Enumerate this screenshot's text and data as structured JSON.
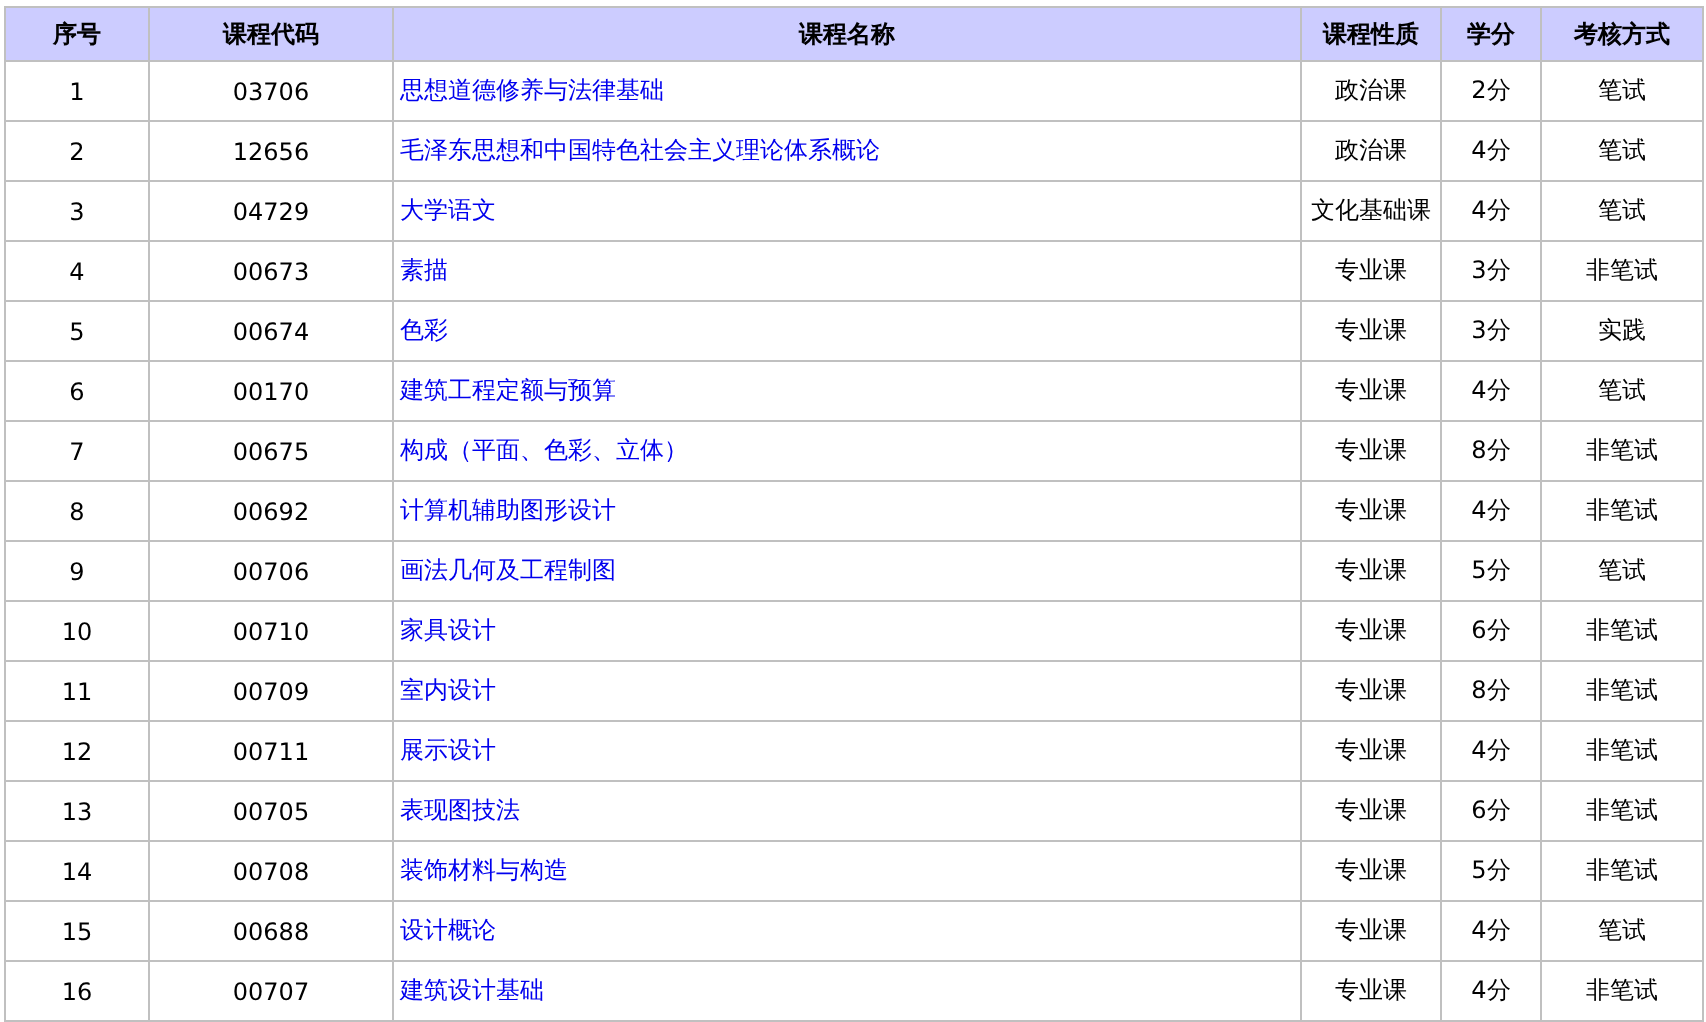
{
  "table": {
    "columns": [
      "序号",
      "课程代码",
      "课程名称",
      "课程性质",
      "学分",
      "考核方式"
    ],
    "rows": [
      {
        "index": "1",
        "code": "03706",
        "name": "思想道德修养与法律基础",
        "nature": "政治课",
        "credits": "2分",
        "exam": "笔试"
      },
      {
        "index": "2",
        "code": "12656",
        "name": "毛泽东思想和中国特色社会主义理论体系概论",
        "nature": "政治课",
        "credits": "4分",
        "exam": "笔试"
      },
      {
        "index": "3",
        "code": "04729",
        "name": "大学语文",
        "nature": "文化基础课",
        "credits": "4分",
        "exam": "笔试"
      },
      {
        "index": "4",
        "code": "00673",
        "name": "素描",
        "nature": "专业课",
        "credits": "3分",
        "exam": "非笔试"
      },
      {
        "index": "5",
        "code": "00674",
        "name": "色彩",
        "nature": "专业课",
        "credits": "3分",
        "exam": "实践"
      },
      {
        "index": "6",
        "code": "00170",
        "name": "建筑工程定额与预算",
        "nature": "专业课",
        "credits": "4分",
        "exam": "笔试"
      },
      {
        "index": "7",
        "code": "00675",
        "name": "构成（平面、色彩、立体）",
        "nature": "专业课",
        "credits": "8分",
        "exam": "非笔试"
      },
      {
        "index": "8",
        "code": "00692",
        "name": "计算机辅助图形设计",
        "nature": "专业课",
        "credits": "4分",
        "exam": "非笔试"
      },
      {
        "index": "9",
        "code": "00706",
        "name": "画法几何及工程制图",
        "nature": "专业课",
        "credits": "5分",
        "exam": "笔试"
      },
      {
        "index": "10",
        "code": "00710",
        "name": "家具设计",
        "nature": "专业课",
        "credits": "6分",
        "exam": "非笔试"
      },
      {
        "index": "11",
        "code": "00709",
        "name": "室内设计",
        "nature": "专业课",
        "credits": "8分",
        "exam": "非笔试"
      },
      {
        "index": "12",
        "code": "00711",
        "name": "展示设计",
        "nature": "专业课",
        "credits": "4分",
        "exam": "非笔试"
      },
      {
        "index": "13",
        "code": "00705",
        "name": "表现图技法",
        "nature": "专业课",
        "credits": "6分",
        "exam": "非笔试"
      },
      {
        "index": "14",
        "code": "00708",
        "name": "装饰材料与构造",
        "nature": "专业课",
        "credits": "5分",
        "exam": "非笔试"
      },
      {
        "index": "15",
        "code": "00688",
        "name": "设计概论",
        "nature": "专业课",
        "credits": "4分",
        "exam": "笔试"
      },
      {
        "index": "16",
        "code": "00707",
        "name": "建筑设计基础",
        "nature": "专业课",
        "credits": "4分",
        "exam": "非笔试"
      }
    ]
  }
}
